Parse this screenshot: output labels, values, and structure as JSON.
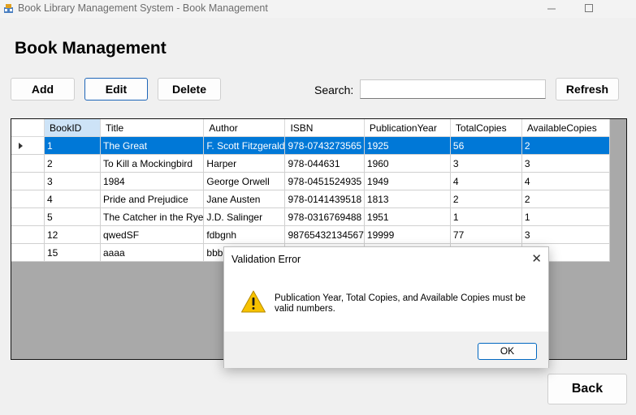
{
  "window": {
    "title": "Book Library Management System - Book Management"
  },
  "page": {
    "heading": "Book Management"
  },
  "toolbar": {
    "add_label": "Add",
    "edit_label": "Edit",
    "delete_label": "Delete",
    "search_label": "Search:",
    "search_value": "",
    "refresh_label": "Refresh"
  },
  "grid": {
    "columns": [
      "BookID",
      "Title",
      "Author",
      "ISBN",
      "PublicationYear",
      "TotalCopies",
      "AvailableCopies"
    ],
    "selected_row": 0,
    "rows": [
      [
        "1",
        "The Great",
        "F. Scott Fitzgerald",
        "978-0743273565",
        "1925",
        "56",
        "2"
      ],
      [
        "2",
        "To Kill a Mockingbird",
        "Harper",
        "978-044631",
        "1960",
        "3",
        "3"
      ],
      [
        "3",
        "1984",
        "George Orwell",
        "978-0451524935",
        "1949",
        "4",
        "4"
      ],
      [
        "4",
        "Pride and Prejudice",
        "Jane Austen",
        "978-0141439518",
        "1813",
        "2",
        "2"
      ],
      [
        "5",
        "The Catcher in the Rye",
        "J.D. Salinger",
        "978-0316769488",
        "1951",
        "1",
        "1"
      ],
      [
        "12",
        "qwedSF",
        "fdbgnh",
        "98765432134567",
        "19999",
        "77",
        "3"
      ],
      [
        "15",
        "aaaa",
        "bbbbbb",
        "",
        "",
        "",
        ""
      ]
    ]
  },
  "dialog": {
    "title": "Validation Error",
    "message": "Publication Year, Total Copies, and Available Copies must be valid numbers.",
    "ok_label": "OK",
    "icon": "warning-icon"
  },
  "footer": {
    "back_label": "Back"
  },
  "colors": {
    "selection": "#0078d7",
    "accent": "#0067c0",
    "warning": "#f7c200"
  }
}
